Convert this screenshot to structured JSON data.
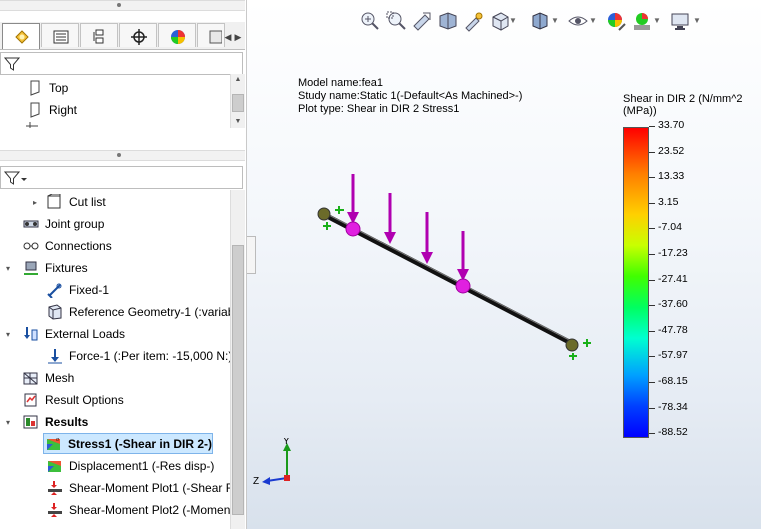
{
  "left_panel": {
    "feature_items": [
      {
        "label": "Top"
      },
      {
        "label": "Right"
      }
    ],
    "study_items": [
      {
        "label": "Cut list",
        "expander": "▸"
      },
      {
        "label": "Joint group",
        "expander": ""
      },
      {
        "label": "Connections",
        "expander": ""
      },
      {
        "label": "Fixtures",
        "expander": "▾"
      },
      {
        "label": "Fixed-1",
        "expander": ""
      },
      {
        "label": "Reference Geometry-1 (:variab",
        "expander": ""
      },
      {
        "label": "External Loads",
        "expander": "▾"
      },
      {
        "label": "Force-1 (:Per item: -15,000 N:)",
        "expander": ""
      },
      {
        "label": "Mesh",
        "expander": ""
      },
      {
        "label": "Result Options",
        "expander": ""
      },
      {
        "label": "Results",
        "expander": "▾"
      },
      {
        "label": "Stress1 (-Shear in DIR 2-)",
        "expander": ""
      },
      {
        "label": "Displacement1 (-Res disp-)",
        "expander": ""
      },
      {
        "label": "Shear-Moment Plot1 (-Shear F",
        "expander": ""
      },
      {
        "label": "Shear-Moment Plot2 (-Momen",
        "expander": ""
      }
    ]
  },
  "viewport": {
    "model_name": "Model name:fea1",
    "study_name": "Study name:Static 1(-Default<As Machined>-)",
    "plot_type": "Plot type: Shear in DIR 2 Stress1",
    "legend_title": "Shear in DIR 2 (N/mm^2 (MPa))",
    "legend_values": [
      "33.70",
      "23.52",
      "13.33",
      "3.15",
      "-7.04",
      "-17.23",
      "-27.41",
      "-37.60",
      "-47.78",
      "-57.97",
      "-68.15",
      "-78.34",
      "-88.52"
    ],
    "triad": {
      "y": "Y",
      "z": "Z"
    }
  },
  "colors": {
    "accent": "#cc00cc",
    "selection": "#cce8ff"
  }
}
